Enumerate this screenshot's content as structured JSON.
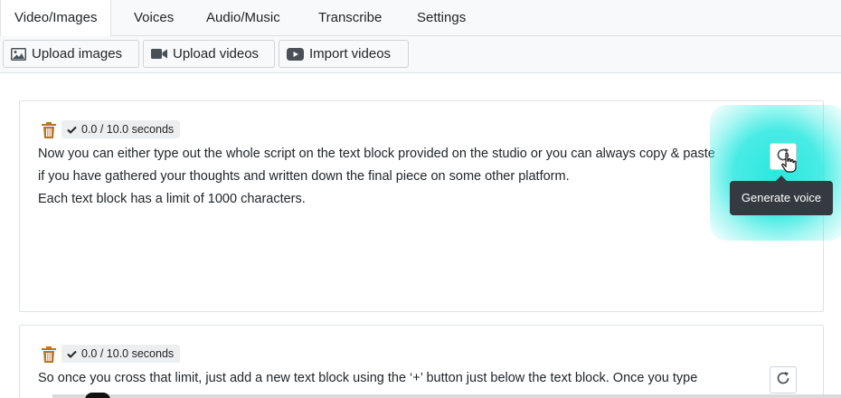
{
  "tabs": [
    {
      "label": "Video/Images",
      "active": true
    },
    {
      "label": "Voices",
      "active": false
    },
    {
      "label": "Audio/Music",
      "active": false
    },
    {
      "label": "Transcribe",
      "active": false
    },
    {
      "label": "Settings",
      "active": false
    }
  ],
  "toolbar": {
    "upload_images": {
      "label": "Upload images",
      "icon": "image-icon"
    },
    "upload_videos": {
      "label": "Upload videos",
      "icon": "video-camera-icon"
    },
    "import_videos": {
      "label": "Import videos",
      "icon": "youtube-play-icon"
    }
  },
  "blocks": [
    {
      "duration": "0.0 / 10.0 seconds",
      "lines": [
        "Now you can either type out the whole script on the text block provided on the studio or you can always copy & paste",
        "if you have gathered your thoughts and written down the final piece on some other platform.",
        "Each text block has a limit of 1000 characters."
      ]
    },
    {
      "duration": "0.0 / 10.0 seconds",
      "lines": [
        "So once you cross that limit, just add a new text block using the ‘+’ button just below the text block. Once you type"
      ]
    }
  ],
  "tooltip": {
    "text": "Generate voice"
  },
  "colors": {
    "trash": "#b8762a",
    "highlight": "#2ee6dc",
    "tooltip_bg": "#343a40",
    "badge_bg": "#eceef0"
  }
}
